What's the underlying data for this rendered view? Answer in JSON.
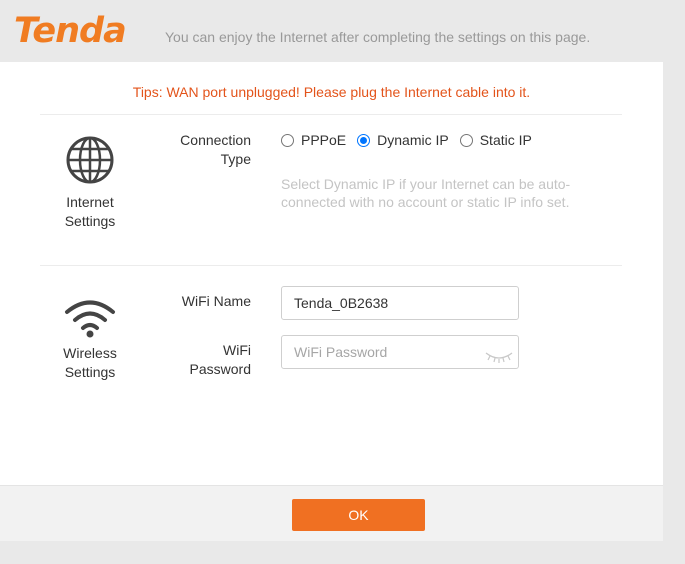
{
  "header": {
    "logo_text": "Tenda",
    "subtitle": "You can enjoy the Internet after completing the settings on this page."
  },
  "tips": "Tips: WAN port unplugged! Please plug the Internet cable into it.",
  "internet": {
    "section_label_line1": "Internet",
    "section_label_line2": "Settings",
    "icon": "globe-icon",
    "connection_label_line1": "Connection",
    "connection_label_line2": "Type",
    "options": [
      {
        "label": "PPPoE",
        "selected": false
      },
      {
        "label": "Dynamic IP",
        "selected": true
      },
      {
        "label": "Static IP",
        "selected": false
      }
    ],
    "hint_line1": "Select Dynamic IP if your Internet can be auto-",
    "hint_line2": "connected with no account or static IP info set."
  },
  "wireless": {
    "section_label_line1": "Wireless",
    "section_label_line2": "Settings",
    "icon": "wifi-icon",
    "wifi_name_label": "WiFi Name",
    "wifi_name_value": "Tenda_0B2638",
    "wifi_password_label_line1": "WiFi",
    "wifi_password_label_line2": "Password",
    "wifi_password_placeholder": "WiFi Password",
    "password_toggle_icon": "eye-closed-icon"
  },
  "footer": {
    "ok_label": "OK"
  },
  "colors": {
    "brand": "#f07c22",
    "button": "#f07022",
    "tips": "#e3541b",
    "radio_selected": "#0075ff"
  }
}
